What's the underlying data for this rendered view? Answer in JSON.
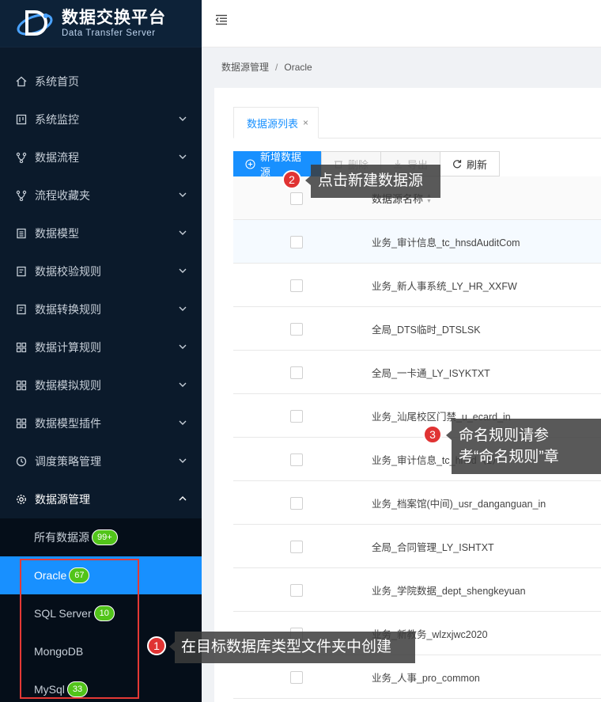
{
  "app": {
    "title": "数据交换平台",
    "subtitle": "Data Transfer Server"
  },
  "sidebar": {
    "items": [
      {
        "label": "系统首页",
        "icon": "home-icon"
      },
      {
        "label": "系统监控",
        "icon": "monitor-icon"
      },
      {
        "label": "数据流程",
        "icon": "flow-icon"
      },
      {
        "label": "流程收藏夹",
        "icon": "flow-icon"
      },
      {
        "label": "数据模型",
        "icon": "list-icon"
      },
      {
        "label": "数据校验规则",
        "icon": "doc-icon"
      },
      {
        "label": "数据转换规则",
        "icon": "doc-icon"
      },
      {
        "label": "数据计算规则",
        "icon": "grid-icon"
      },
      {
        "label": "数据模拟规则",
        "icon": "grid-icon"
      },
      {
        "label": "数据模型插件",
        "icon": "grid-icon"
      },
      {
        "label": "调度策略管理",
        "icon": "clock-icon"
      },
      {
        "label": "数据源管理",
        "icon": "gear-icon"
      }
    ],
    "submenu": [
      {
        "label": "所有数据源",
        "badge": "99+"
      },
      {
        "label": "Oracle",
        "badge": "67"
      },
      {
        "label": "SQL Server",
        "badge": "10"
      },
      {
        "label": "MongoDB",
        "badge": ""
      },
      {
        "label": "MySql",
        "badge": "33"
      }
    ]
  },
  "breadcrumb": {
    "parent": "数据源管理",
    "separator": "/",
    "current": "Oracle"
  },
  "tabs": {
    "active_label": "数据源列表",
    "close_glyph": "×"
  },
  "toolbar": {
    "new_label": "新增数据源",
    "delete_label": "删除",
    "export_label": "导出",
    "refresh_label": "刷新"
  },
  "table": {
    "header_name": "数据源名称",
    "rows": [
      "业务_审计信息_tc_hnsdAuditCom",
      "业务_新人事系统_LY_HR_XXFW",
      "全局_DTS临时_DTSLSK",
      "全局_一卡通_LY_ISYKTXT",
      "业务_汕尾校区门禁_u_ecard_in",
      "业务_审计信息_tc_hnsd（1）",
      "业务_档案馆(中间)_usr_danganguan_in",
      "全局_合同管理_LY_ISHTXT",
      "业务_学院数据_dept_shengkeyuan",
      "业务_新教务_wlzxjwc2020",
      "业务_人事_pro_common"
    ]
  },
  "annotations": {
    "step1_num": "1",
    "step1_text": "在目标数据库类型文件夹中创建",
    "step2_num": "2",
    "step2_text": "点击新建数据源",
    "step3_num": "3",
    "step3_line1": "命名规则请参",
    "step3_line2": "考“命名规则”章"
  },
  "colors": {
    "sidebar_bg": "#0b1a2b",
    "accent": "#1890ff",
    "badge": "#52c41a",
    "annotation_red": "#e03333"
  }
}
